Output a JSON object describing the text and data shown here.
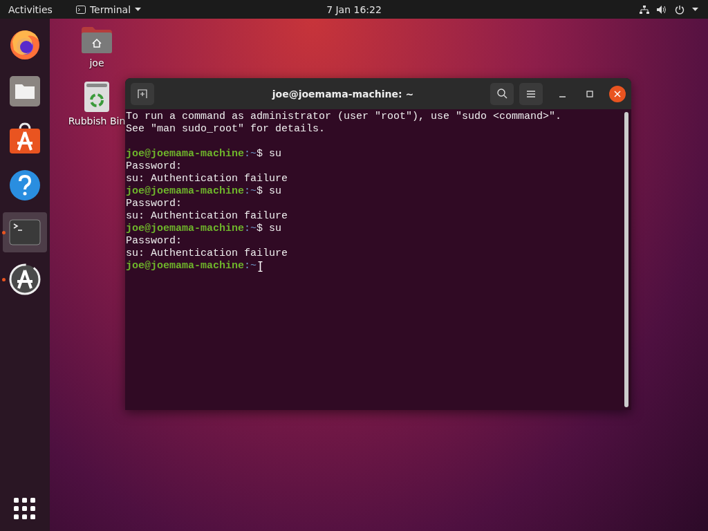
{
  "top_bar": {
    "activities": "Activities",
    "app_menu": "Terminal",
    "clock": "7 Jan  16:22"
  },
  "dock": {
    "items": [
      {
        "kind": "browser",
        "running": false,
        "selected": false
      },
      {
        "kind": "files",
        "running": false,
        "selected": false
      },
      {
        "kind": "software",
        "running": false,
        "selected": false
      },
      {
        "kind": "help",
        "running": false,
        "selected": false
      },
      {
        "kind": "terminal",
        "running": true,
        "selected": true
      },
      {
        "kind": "updater",
        "running": true,
        "selected": false
      }
    ]
  },
  "desktop_icons": [
    {
      "kind": "home",
      "label": "joe"
    },
    {
      "kind": "trash",
      "label": "Rubbish Bin"
    }
  ],
  "terminal_window": {
    "title": "joe@joemama-machine: ~",
    "lines": [
      {
        "kind": "output",
        "text": "To run a command as administrator (user \"root\"), use \"sudo <command>\"."
      },
      {
        "kind": "output",
        "text": "See \"man sudo_root\" for details."
      },
      {
        "kind": "blank"
      },
      {
        "kind": "prompt",
        "user_host": "joe@joemama-machine",
        "path": ":~",
        "symbol": "$",
        "command": "su"
      },
      {
        "kind": "output",
        "text": "Password:"
      },
      {
        "kind": "output",
        "text": "su: Authentication failure"
      },
      {
        "kind": "prompt",
        "user_host": "joe@joemama-machine",
        "path": ":~",
        "symbol": "$",
        "command": "su"
      },
      {
        "kind": "output",
        "text": "Password:"
      },
      {
        "kind": "output",
        "text": "su: Authentication failure"
      },
      {
        "kind": "prompt",
        "user_host": "joe@joemama-machine",
        "path": ":~",
        "symbol": "$",
        "command": "su"
      },
      {
        "kind": "output",
        "text": "Password:"
      },
      {
        "kind": "output",
        "text": "su: Authentication failure"
      },
      {
        "kind": "prompt",
        "user_host": "joe@joemama-machine",
        "path": ":~"
      }
    ]
  }
}
